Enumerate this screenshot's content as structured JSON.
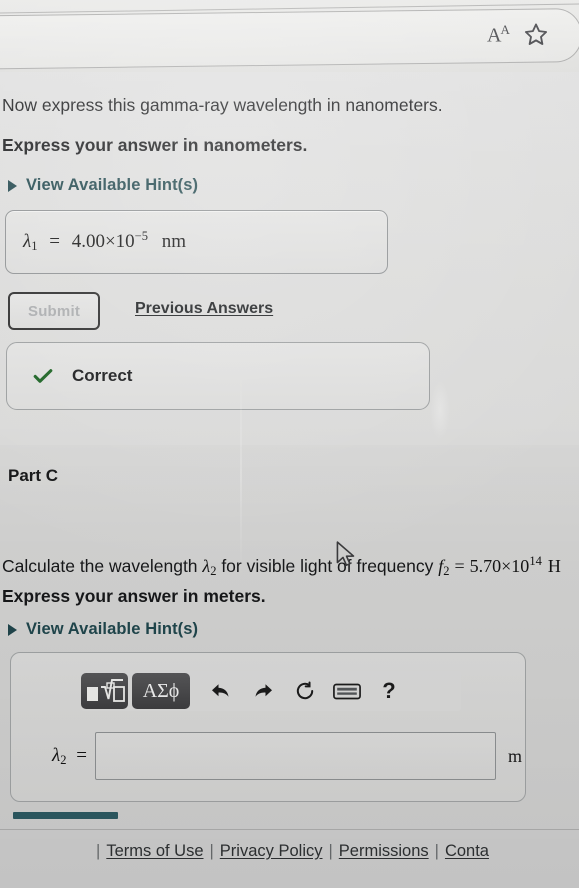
{
  "browser": {
    "text_size_icon_label": "A",
    "text_size_icon_small": "A",
    "bookmark_icon_name": "star-icon"
  },
  "part_b": {
    "question": "Now express this gamma-ray wavelength in nanometers.",
    "instruction": "Express your answer in nanometers.",
    "hints_label": "View Available Hint(s)",
    "answer": {
      "symbol": "λ",
      "subscript": "1",
      "equals": "=",
      "value": "4.00×10",
      "exponent": "−5",
      "unit": "nm"
    },
    "submit_label": "Submit",
    "previous_answers_label": "Previous Answers",
    "feedback": "Correct"
  },
  "part_c": {
    "heading": "Part C",
    "question_pre": "Calculate the wavelength ",
    "question_symbol": "λ",
    "question_sub": "2",
    "question_mid": " for visible light of frequency ",
    "freq_symbol": "f",
    "freq_sub": "2",
    "freq_equals": "=",
    "freq_value": "5.70×10",
    "freq_exp": "14",
    "freq_unit_truncated": "H",
    "instruction": "Express your answer in meters.",
    "hints_label": "View Available Hint(s)",
    "toolbar": {
      "templates_label": "□",
      "greek_label": "ΑΣϕ",
      "undo_icon": "undo-icon",
      "redo_icon": "redo-icon",
      "reset_icon": "reset-icon",
      "keyboard_icon": "keyboard-icon",
      "help_label": "?"
    },
    "answer": {
      "symbol": "λ",
      "subscript": "2",
      "equals": "=",
      "value": "",
      "placeholder": "",
      "unit": "m"
    }
  },
  "footer": {
    "leading_sep": "|",
    "links": [
      "Terms of Use",
      "Privacy Policy",
      "Permissions",
      "Conta"
    ],
    "separator": "|"
  },
  "colors": {
    "page_background": "#d9d9d7",
    "hint_link": "#20474d",
    "correct_check": "#17601f",
    "toolbar_button": "#3e3e40",
    "progress_bar": "#2c5a62"
  }
}
